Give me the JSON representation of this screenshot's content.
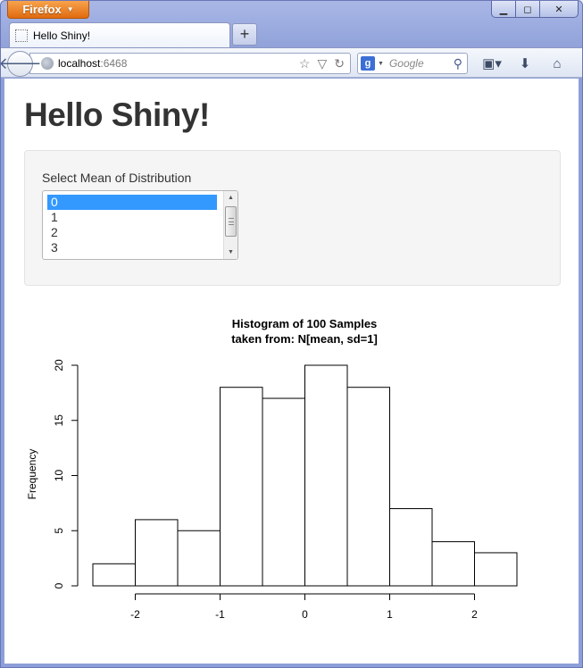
{
  "browser": {
    "app_button": "Firefox",
    "tab_title": "Hello Shiny!",
    "url_host": "localhost",
    "url_port": ":6468",
    "search_placeholder": "Google"
  },
  "page": {
    "title": "Hello Shiny!",
    "select_label": "Select Mean of Distribution",
    "select_options": [
      "0",
      "1",
      "2",
      "3"
    ],
    "selected_index": 0
  },
  "chart_data": {
    "type": "bar",
    "title": "Histogram of 100 Samples",
    "subtitle": "taken from: N[mean, sd=1]",
    "xlabel": "",
    "ylabel": "Frequency",
    "bin_edges": [
      -2.5,
      -2.0,
      -1.5,
      -1.0,
      -0.5,
      0.0,
      0.5,
      1.0,
      1.5,
      2.0,
      2.5
    ],
    "values": [
      2,
      6,
      5,
      18,
      17,
      20,
      18,
      7,
      4,
      3
    ],
    "xticks": [
      -2,
      -1,
      0,
      1,
      2
    ],
    "yticks": [
      0,
      5,
      10,
      15,
      20
    ],
    "xlim": [
      -2.5,
      2.5
    ],
    "ylim": [
      0,
      20
    ],
    "grid": false,
    "bar_fill": "#ffffff",
    "bar_stroke": "#000000"
  }
}
